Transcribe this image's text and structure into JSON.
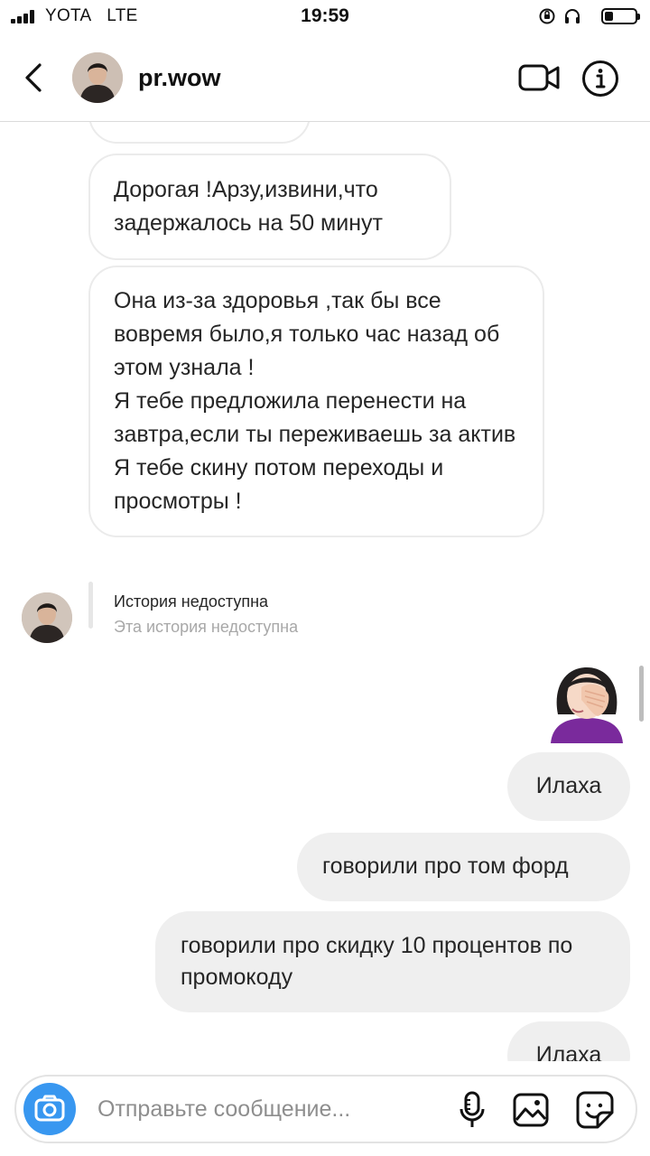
{
  "status_bar": {
    "carrier": "YOTA",
    "network": "LTE",
    "time": "19:59"
  },
  "header": {
    "username": "pr.wow",
    "icons": [
      "back-chevron-icon",
      "video-call-icon",
      "info-icon"
    ]
  },
  "messages": {
    "incoming_1": {
      "text": "Дорогая !Арзу,извини,что задержалось на 50 минут"
    },
    "incoming_2": {
      "lines": [
        "Она из-за здоровья ,так бы все вовремя было,я только час назад об этом узнала !",
        "Я тебе предложила перенести на завтра,если ты переживаешь за актив",
        "Я тебе скину потом переходы и просмотры !"
      ]
    },
    "story_reply": {
      "title": "История недоступна",
      "subtitle": "Эта история недоступна"
    },
    "outgoing_emoji": "🤦🏻‍♀️",
    "outgoing": [
      "Илаха",
      "говорили про том форд",
      "говорили про скидку 10 процентов по промокоду",
      "Илаха"
    ]
  },
  "composer": {
    "placeholder": "Отправьте сообщение...",
    "icons": [
      "camera-icon",
      "microphone-icon",
      "gallery-icon",
      "sticker-icon"
    ]
  },
  "colors": {
    "accent": "#3897f0",
    "outgoing_bubble": "#efefef",
    "incoming_border": "#ebebeb",
    "secondary_text": "#a8a8a8"
  }
}
